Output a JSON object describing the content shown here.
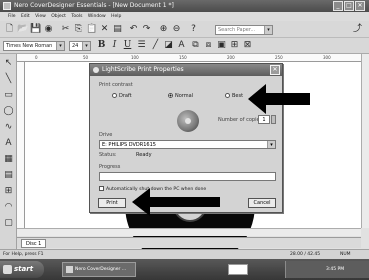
{
  "window": {
    "title": "Nero CoverDesigner Essentials - [New Document 1 *]",
    "menu": [
      "File",
      "Edit",
      "View",
      "Object",
      "Tools",
      "Window",
      "Help"
    ]
  },
  "toolbar": {
    "font_name": "Times New Roman",
    "font_size": "24",
    "search_placeholder": "Search Paper..."
  },
  "dialog": {
    "title": "LightScribe Print Properties",
    "contrast_label": "Print contrast",
    "contrast_options": [
      "Draft",
      "Normal",
      "Best"
    ],
    "contrast_selected": "Normal",
    "copies_label": "Number of copies:",
    "copies_value": "1",
    "drive_label": "Drive",
    "drive_value": "E: PHILIPS DVDR1615",
    "status_label": "Status:",
    "status_value": "Ready",
    "progress_label": "Progress",
    "progress_value": 0,
    "autoshutdown_label": "Automatically shut down the PC when done",
    "print_button": "Print",
    "cancel_button": "Cancel"
  },
  "workspace": {
    "ruler_marks": [
      "0",
      "50",
      "100",
      "150",
      "200",
      "250",
      "300"
    ],
    "doc_tab": "Disc 1"
  },
  "statusbar": {
    "left": "For Help, press F1",
    "coords": "28.00 / 42.45",
    "mode": "NUM"
  },
  "taskbar": {
    "start_label": "start",
    "window_item": "Nero CoverDesigner ...",
    "clock": "3:45 PM"
  },
  "colors": {
    "annotation_arrow": "#000000",
    "disc": "#0e0e0e"
  }
}
